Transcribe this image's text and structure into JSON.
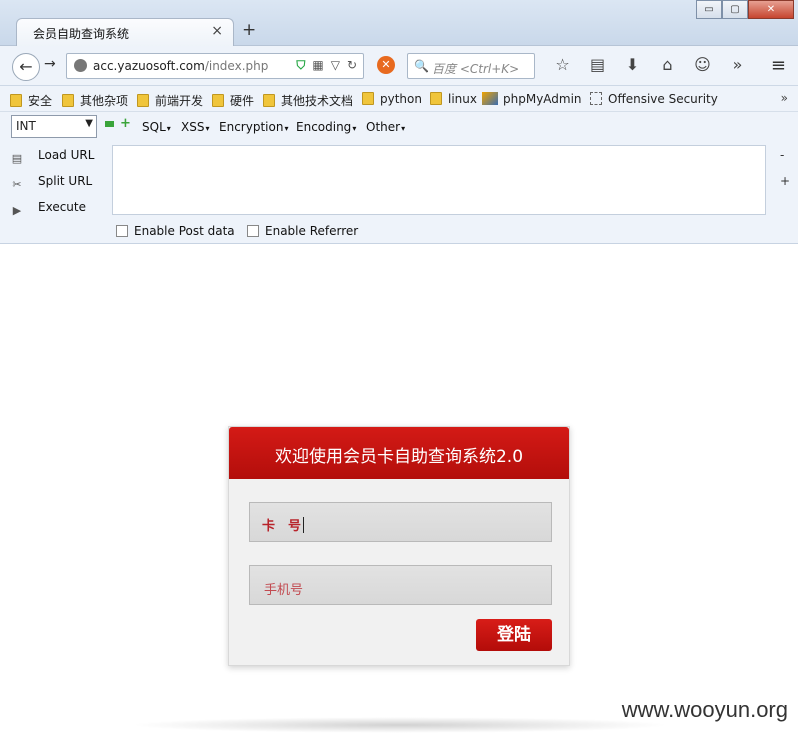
{
  "window": {
    "tab_title": "会员自助查询系统",
    "tab_close": "×",
    "new_tab": "+",
    "min": "▭",
    "max": "▢",
    "close": "✕"
  },
  "navbar": {
    "url_host": "acc.yazuosoft.com",
    "url_path": "/index.php",
    "search_placeholder": "百度 <Ctrl+K>",
    "search_icon": "🔍",
    "back": "←",
    "forward": "→",
    "noscript": "✕",
    "icons": [
      "☆",
      "▤",
      "⬇",
      "⌂",
      "☺",
      "»"
    ],
    "menu": "≡"
  },
  "bookmarks": {
    "items": [
      "安全",
      "其他杂项",
      "前端开发",
      "硬件",
      "其他技术文档",
      "python",
      "linux",
      "phpMyAdmin",
      "Offensive Security"
    ],
    "more": "»"
  },
  "hackbar": {
    "select_value": "INT",
    "menu": [
      "SQL",
      "XSS",
      "Encryption",
      "Encoding",
      "Other"
    ],
    "actions": [
      "Load URL",
      "Split URL",
      "Execute"
    ],
    "minus": "-",
    "plus": "+",
    "post_label": "Enable Post data",
    "referrer_label": "Enable Referrer"
  },
  "login": {
    "title": "欢迎使用会员卡自助查询系统2.0",
    "card_label": "卡　号",
    "phone_placeholder": "手机号",
    "submit": "登陆"
  },
  "watermark": "www.wooyun.org",
  "colors": {
    "header_red": "#c8140f",
    "button_red": "#c5110d",
    "label_red": "#b8232a",
    "chrome_blue": "#eef3fa"
  }
}
